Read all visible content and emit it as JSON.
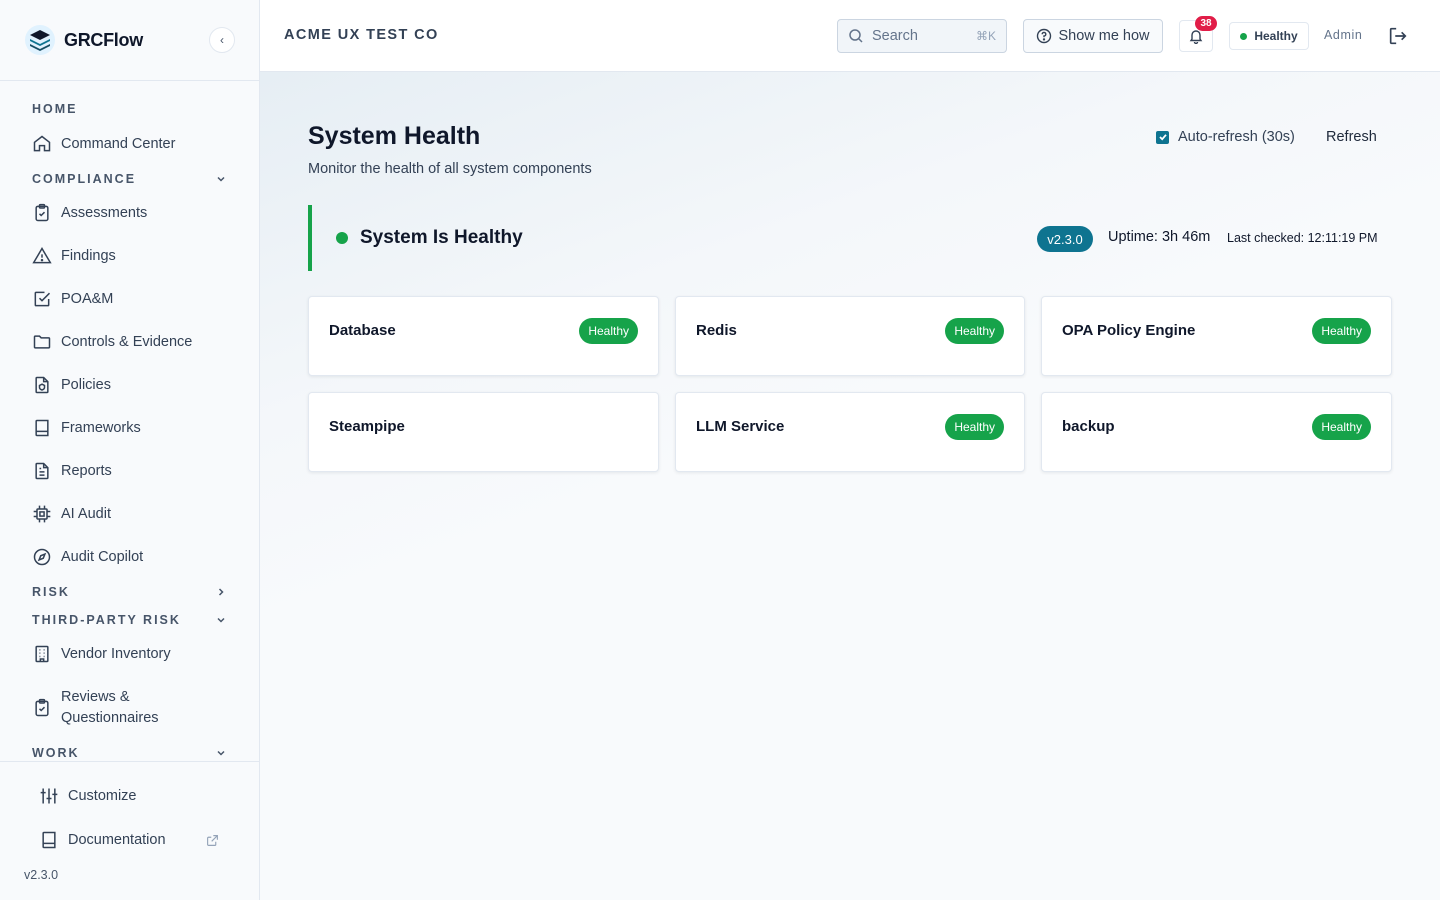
{
  "app": {
    "name": "GRCFlow",
    "version": "v2.3.0"
  },
  "header": {
    "org_name": "ACME UX TEST CO",
    "search_placeholder": "Search",
    "search_shortcut": "⌘K",
    "help_label": "Show me how",
    "notification_count": "38",
    "health_label": "Healthy",
    "user_label": "Admin"
  },
  "sidebar": {
    "sections": [
      {
        "label": "HOME",
        "state": "none"
      },
      {
        "label": "COMPLIANCE",
        "state": "expanded"
      },
      {
        "label": "RISK",
        "state": "collapsed"
      },
      {
        "label": "THIRD-PARTY RISK",
        "state": "expanded"
      },
      {
        "label": "WORK",
        "state": "expanded"
      }
    ],
    "items": [
      {
        "label": "Command Center",
        "icon": "home-icon"
      },
      {
        "label": "Assessments",
        "icon": "clipboard-check-icon"
      },
      {
        "label": "Findings",
        "icon": "warning-triangle-icon"
      },
      {
        "label": "POA&M",
        "icon": "check-square-icon"
      },
      {
        "label": "Controls & Evidence",
        "icon": "folder-icon"
      },
      {
        "label": "Policies",
        "icon": "file-shield-icon"
      },
      {
        "label": "Frameworks",
        "icon": "book-icon"
      },
      {
        "label": "Reports",
        "icon": "file-text-icon"
      },
      {
        "label": "AI Audit",
        "icon": "cpu-icon"
      },
      {
        "label": "Audit Copilot",
        "icon": "compass-icon"
      },
      {
        "label": "Vendor Inventory",
        "icon": "building-icon"
      },
      {
        "label": "Reviews & Questionnaires",
        "icon": "clipboard-check-icon"
      }
    ],
    "footer": {
      "customize": "Customize",
      "documentation": "Documentation",
      "version": "v2.3.0"
    }
  },
  "page": {
    "title": "System Health",
    "subtitle": "Monitor the health of all system components",
    "auto_refresh_label": "Auto-refresh (30s)",
    "auto_refresh_checked": true,
    "refresh_label": "Refresh"
  },
  "status": {
    "text": "System Is Healthy",
    "version": "v2.3.0",
    "uptime": "Uptime: 3h 46m",
    "last_checked": "Last checked: 12:11:19 PM",
    "color": "#16a34a"
  },
  "components": [
    {
      "name": "Database",
      "status": "Healthy"
    },
    {
      "name": "Redis",
      "status": "Healthy"
    },
    {
      "name": "OPA Policy Engine",
      "status": "Healthy"
    },
    {
      "name": "Steampipe",
      "status": ""
    },
    {
      "name": "LLM Service",
      "status": "Healthy"
    },
    {
      "name": "backup",
      "status": "Healthy"
    }
  ],
  "colors": {
    "accent": "#0e7490",
    "healthy": "#16a34a",
    "badge": "#e11d48"
  }
}
